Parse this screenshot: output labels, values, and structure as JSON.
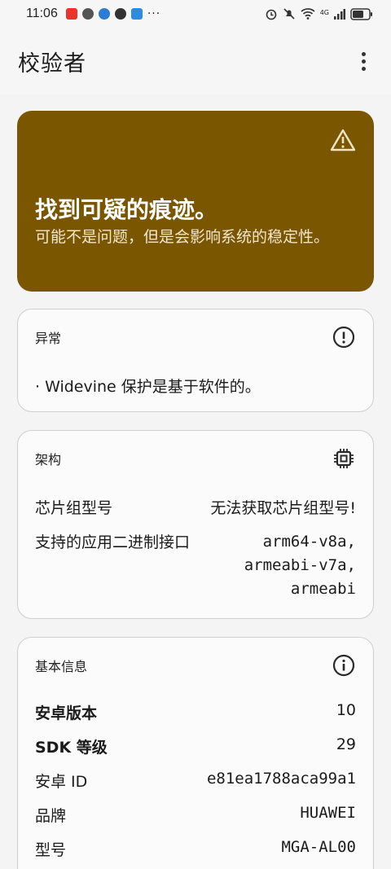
{
  "status_bar": {
    "time": "11:06",
    "network": "4G"
  },
  "app_bar": {
    "title": "校验者"
  },
  "warning": {
    "title": "找到可疑的痕迹。",
    "subtitle": "可能不是问题，但是会影响系统的稳定性。",
    "color": "#7a5600"
  },
  "anomaly_card": {
    "title": "异常",
    "items": [
      "· Widevine 保护是基于软件的。"
    ]
  },
  "arch_card": {
    "title": "架构",
    "chip_label": "芯片组型号",
    "chip_value": "无法获取芯片组型号!",
    "abi_label": "支持的应用二进制接口",
    "abi_values": [
      "arm64-v8a,",
      "armeabi-v7a,",
      "armeabi"
    ]
  },
  "basic_card": {
    "title": "基本信息",
    "android_version_label": "安卓版本",
    "android_version_value": "10",
    "sdk_label": "SDK 等级",
    "sdk_value": "29",
    "android_id_label": "安卓 ID",
    "android_id_value": "e81ea1788aca99a1",
    "brand_label": "品牌",
    "brand_value": "HUAWEI",
    "model_label": "型号",
    "model_value": "MGA-AL00"
  }
}
